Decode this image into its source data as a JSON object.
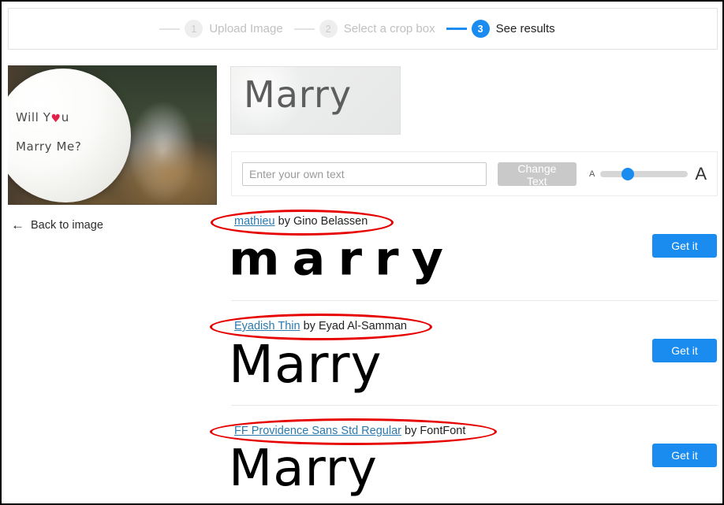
{
  "stepper": {
    "steps": [
      {
        "number": "1",
        "label": "Upload Image",
        "active": false
      },
      {
        "number": "2",
        "label": "Select a crop box",
        "active": false
      },
      {
        "number": "3",
        "label": "See results",
        "active": true
      }
    ]
  },
  "source_image": {
    "alt": "balloon-photo",
    "balloon_line1_a": "Will Y",
    "balloon_line1_b": "u",
    "balloon_line2": "Marry Me?",
    "heart": "♥"
  },
  "crop_preview": {
    "text": "Marry"
  },
  "controls": {
    "input_value": "",
    "input_placeholder": "Enter your own text",
    "change_text_label": "Change Text",
    "size_small_label": "A",
    "size_large_label": "A",
    "slider_percent": 31
  },
  "back": {
    "label": "Back to image",
    "arrow": "←"
  },
  "results": {
    "by_word": "by",
    "get_it_label": "Get it",
    "items": [
      {
        "font_name": "mathieu",
        "author": "Gino Belassen",
        "sample_text": "marry"
      },
      {
        "font_name": "Eyadish Thin",
        "author": "Eyad Al-Samman",
        "sample_text": "Marry"
      },
      {
        "font_name": "FF Providence Sans Std Regular",
        "author": "FontFont",
        "sample_text": "Marry"
      }
    ]
  },
  "colors": {
    "accent": "#1a8cf0",
    "annotation": "#e60000",
    "link": "#2a7ab0",
    "disabled_button": "#c9c9c9"
  }
}
